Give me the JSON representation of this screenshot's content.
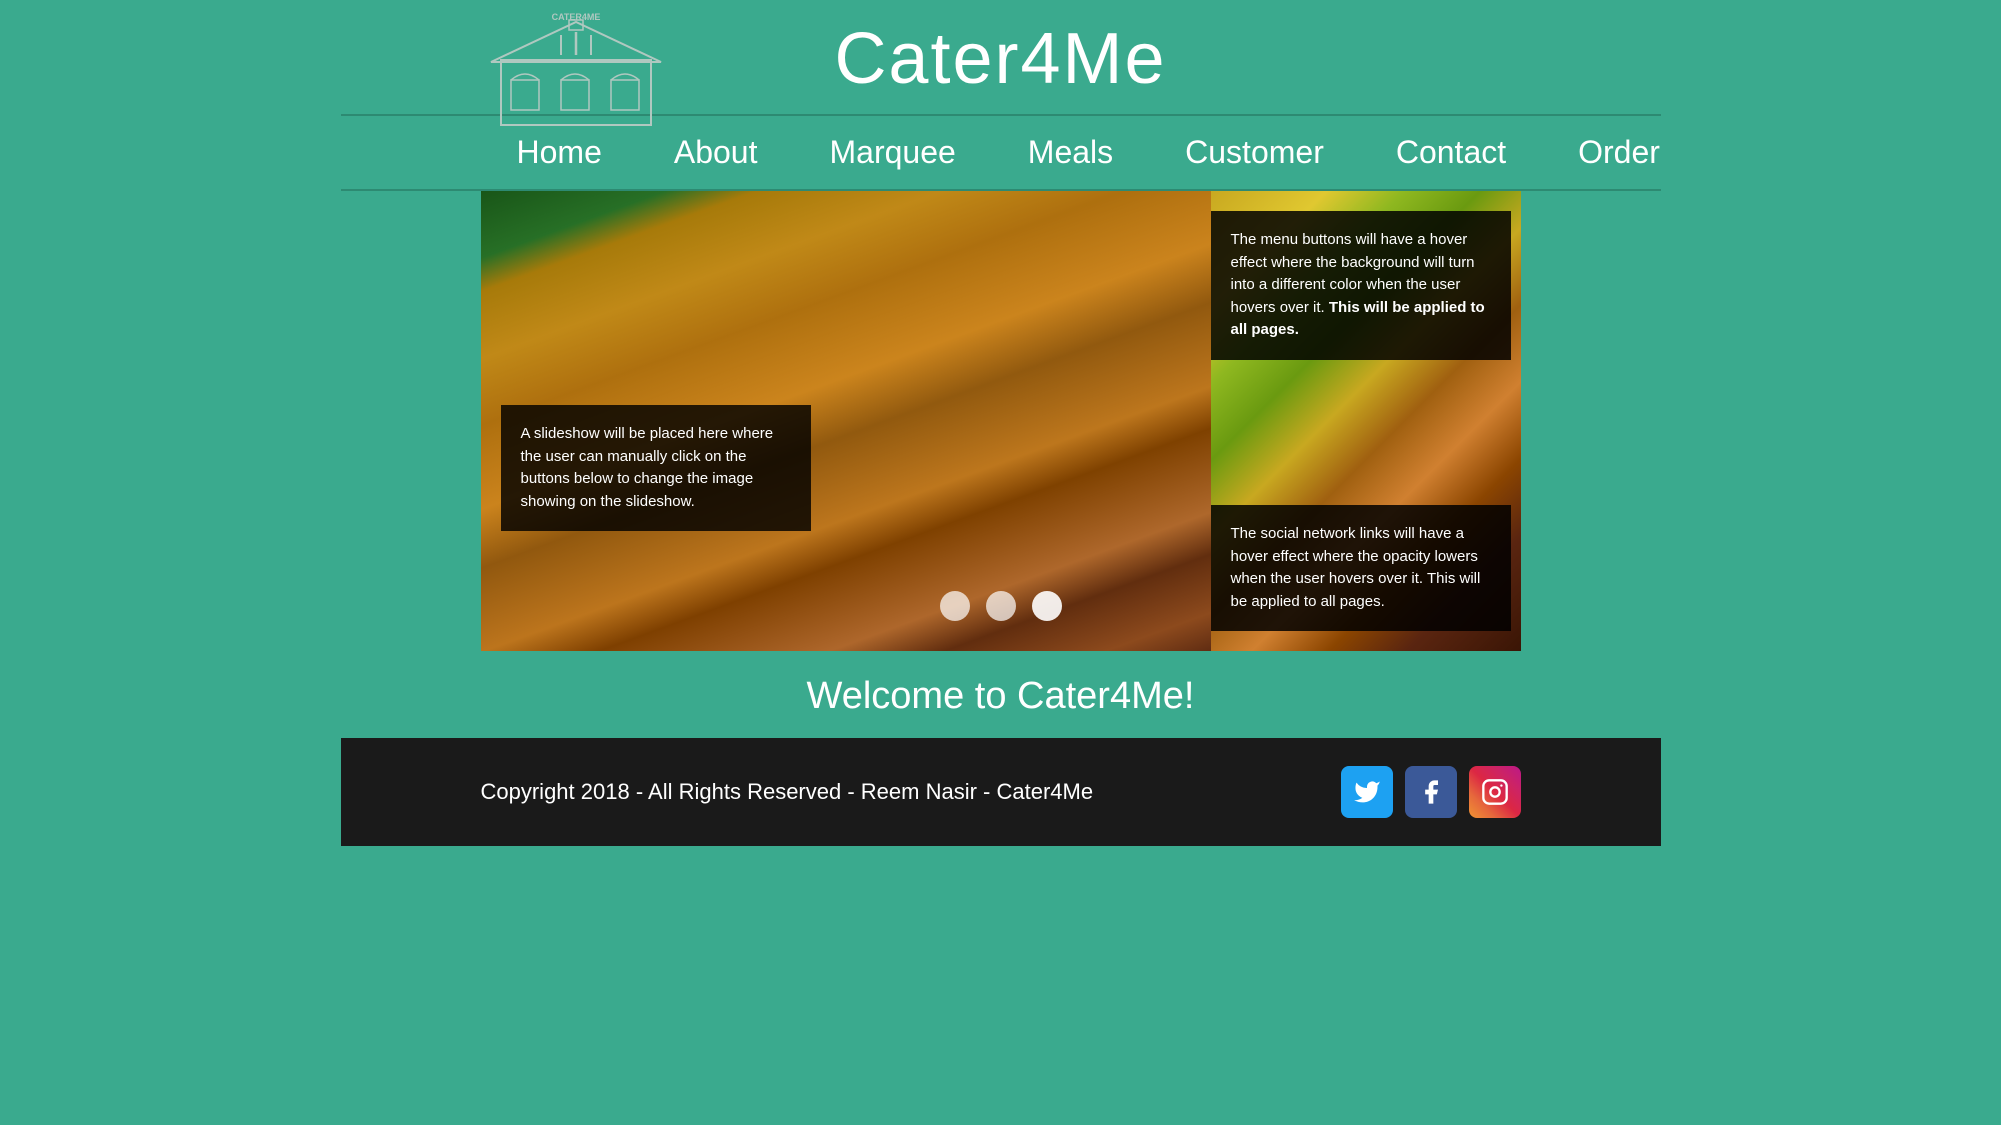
{
  "header": {
    "title": "Cater4Me",
    "logo_alt": "Cater4Me Logo"
  },
  "nav": {
    "items": [
      {
        "label": "Home",
        "id": "home"
      },
      {
        "label": "About",
        "id": "about"
      },
      {
        "label": "Marquee",
        "id": "marquee"
      },
      {
        "label": "Meals",
        "id": "meals"
      },
      {
        "label": "Customer",
        "id": "customer"
      },
      {
        "label": "Contact",
        "id": "contact"
      },
      {
        "label": "Order",
        "id": "order"
      }
    ]
  },
  "slideshow": {
    "text": "A slideshow will be placed here where the user can manually click on the buttons below to change the image showing on the slideshow.",
    "hover_note": "The menu buttons will have a hover effect where the background will turn into a different color when the user hovers over it. ",
    "hover_bold": "This will be applied to all pages.",
    "social_note": "The social network links will have a hover effect where the opacity lowers when the user hovers over it. ",
    "social_bold": "This will be applied to all pages.",
    "dots": [
      {
        "active": false
      },
      {
        "active": false
      },
      {
        "active": true
      }
    ]
  },
  "welcome": {
    "text": "Welcome to Cater4Me!"
  },
  "footer": {
    "copyright": "Copyright 2018 - All Rights Reserved - Reem Nasir - Cater4Me",
    "twitter_label": "Twitter",
    "facebook_label": "Facebook",
    "instagram_label": "Instagram"
  }
}
